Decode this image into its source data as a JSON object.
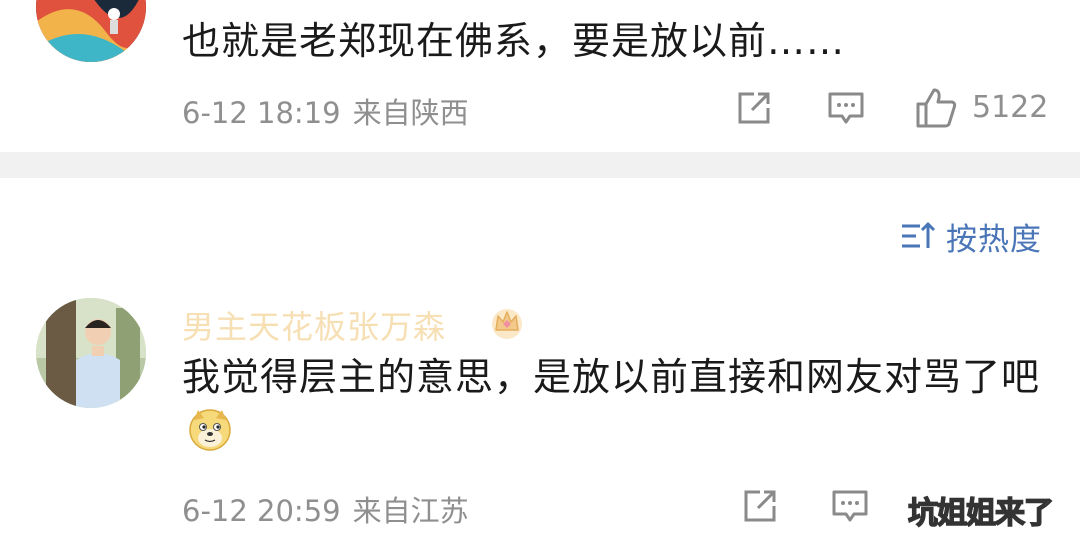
{
  "comments": [
    {
      "text": "也就是老郑现在佛系，要是放以前……",
      "date": "6-12 18:19",
      "location": "来自陕西",
      "likes": "5122"
    },
    {
      "username": "男主天花板张万森",
      "text": "我觉得层主的意思，是放以前直接和网友对骂了吧",
      "emoji": "doge-emoji",
      "date": "6-12 20:59",
      "location": "来自江苏"
    }
  ],
  "sort": {
    "label": "按热度",
    "icon": "sort-icon"
  },
  "watermark": "坑姐姐来了",
  "colors": {
    "username": "#f7dfb4",
    "sort": "#4a76b8",
    "meta": "#8f8f8f",
    "divider": "#f1f1f1"
  }
}
